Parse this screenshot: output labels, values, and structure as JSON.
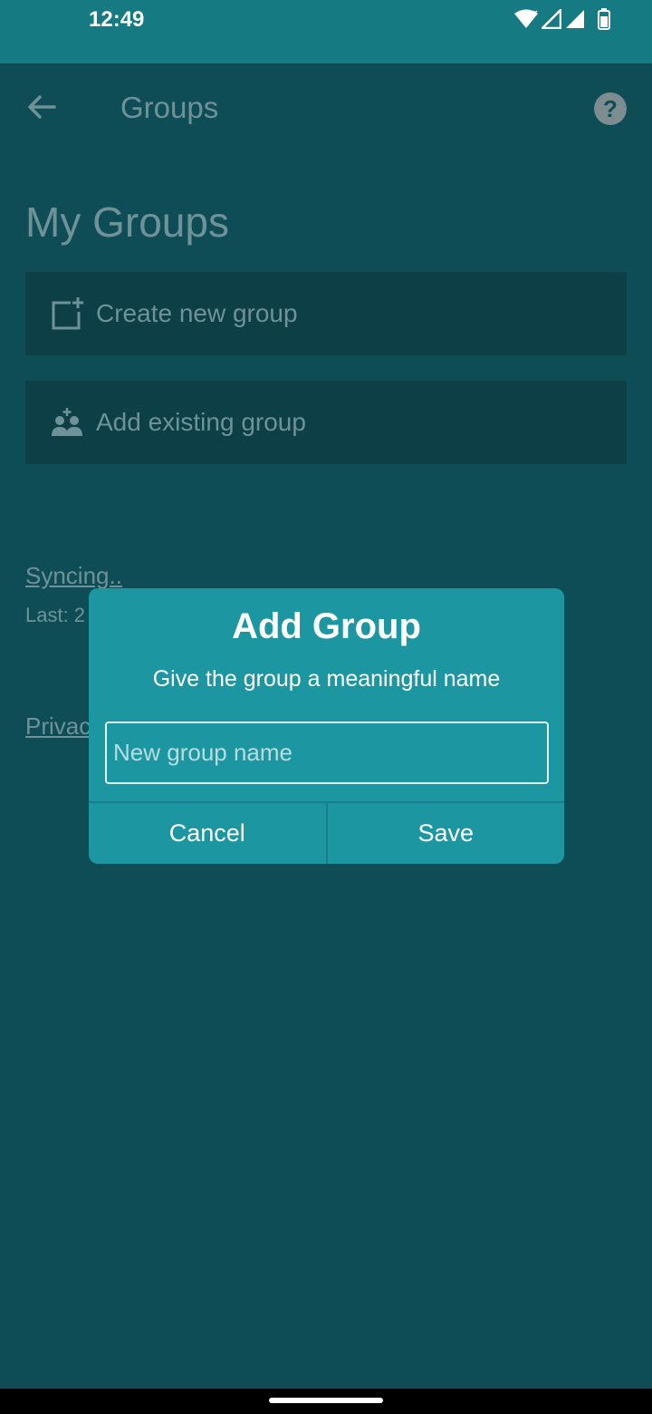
{
  "status_bar": {
    "time": "12:49",
    "icons": [
      "wifi-icon",
      "signal-icon",
      "signal-icon",
      "battery-icon"
    ]
  },
  "app_bar": {
    "title": "Groups",
    "back_icon": "arrow-left-icon",
    "help_icon": "help-circle-icon",
    "help_glyph": "?"
  },
  "main": {
    "heading": "My Groups",
    "actions": [
      {
        "label": "Create new group",
        "icon": "add-box-icon"
      },
      {
        "label": "Add existing group",
        "icon": "group-add-icon"
      }
    ],
    "sync_link": "Syncing..",
    "last_sync": "Last: 2",
    "privacy_link": "Privac"
  },
  "dialog": {
    "title": "Add Group",
    "subtitle": "Give the group a meaningful name",
    "input_placeholder": "New group name",
    "input_value": "",
    "cancel_label": "Cancel",
    "save_label": "Save"
  },
  "colors": {
    "status_bar": "#157a82",
    "background": "#0f4d56",
    "card": "#0c3f46",
    "dialog": "#1c97a2",
    "muted_text": "#6f9299"
  }
}
